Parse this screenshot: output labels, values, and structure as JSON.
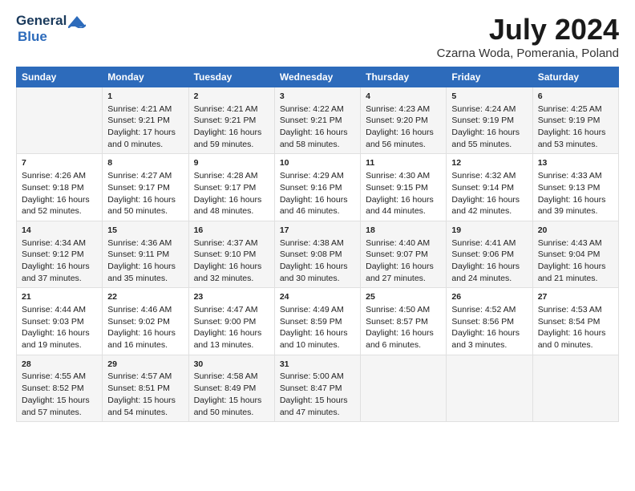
{
  "header": {
    "logo_general": "General",
    "logo_blue": "Blue",
    "main_title": "July 2024",
    "subtitle": "Czarna Woda, Pomerania, Poland"
  },
  "calendar": {
    "weekdays": [
      "Sunday",
      "Monday",
      "Tuesday",
      "Wednesday",
      "Thursday",
      "Friday",
      "Saturday"
    ],
    "weeks": [
      [
        {
          "day": "",
          "content": ""
        },
        {
          "day": "1",
          "content": "Sunrise: 4:21 AM\nSunset: 9:21 PM\nDaylight: 17 hours\nand 0 minutes."
        },
        {
          "day": "2",
          "content": "Sunrise: 4:21 AM\nSunset: 9:21 PM\nDaylight: 16 hours\nand 59 minutes."
        },
        {
          "day": "3",
          "content": "Sunrise: 4:22 AM\nSunset: 9:21 PM\nDaylight: 16 hours\nand 58 minutes."
        },
        {
          "day": "4",
          "content": "Sunrise: 4:23 AM\nSunset: 9:20 PM\nDaylight: 16 hours\nand 56 minutes."
        },
        {
          "day": "5",
          "content": "Sunrise: 4:24 AM\nSunset: 9:19 PM\nDaylight: 16 hours\nand 55 minutes."
        },
        {
          "day": "6",
          "content": "Sunrise: 4:25 AM\nSunset: 9:19 PM\nDaylight: 16 hours\nand 53 minutes."
        }
      ],
      [
        {
          "day": "7",
          "content": "Sunrise: 4:26 AM\nSunset: 9:18 PM\nDaylight: 16 hours\nand 52 minutes."
        },
        {
          "day": "8",
          "content": "Sunrise: 4:27 AM\nSunset: 9:17 PM\nDaylight: 16 hours\nand 50 minutes."
        },
        {
          "day": "9",
          "content": "Sunrise: 4:28 AM\nSunset: 9:17 PM\nDaylight: 16 hours\nand 48 minutes."
        },
        {
          "day": "10",
          "content": "Sunrise: 4:29 AM\nSunset: 9:16 PM\nDaylight: 16 hours\nand 46 minutes."
        },
        {
          "day": "11",
          "content": "Sunrise: 4:30 AM\nSunset: 9:15 PM\nDaylight: 16 hours\nand 44 minutes."
        },
        {
          "day": "12",
          "content": "Sunrise: 4:32 AM\nSunset: 9:14 PM\nDaylight: 16 hours\nand 42 minutes."
        },
        {
          "day": "13",
          "content": "Sunrise: 4:33 AM\nSunset: 9:13 PM\nDaylight: 16 hours\nand 39 minutes."
        }
      ],
      [
        {
          "day": "14",
          "content": "Sunrise: 4:34 AM\nSunset: 9:12 PM\nDaylight: 16 hours\nand 37 minutes."
        },
        {
          "day": "15",
          "content": "Sunrise: 4:36 AM\nSunset: 9:11 PM\nDaylight: 16 hours\nand 35 minutes."
        },
        {
          "day": "16",
          "content": "Sunrise: 4:37 AM\nSunset: 9:10 PM\nDaylight: 16 hours\nand 32 minutes."
        },
        {
          "day": "17",
          "content": "Sunrise: 4:38 AM\nSunset: 9:08 PM\nDaylight: 16 hours\nand 30 minutes."
        },
        {
          "day": "18",
          "content": "Sunrise: 4:40 AM\nSunset: 9:07 PM\nDaylight: 16 hours\nand 27 minutes."
        },
        {
          "day": "19",
          "content": "Sunrise: 4:41 AM\nSunset: 9:06 PM\nDaylight: 16 hours\nand 24 minutes."
        },
        {
          "day": "20",
          "content": "Sunrise: 4:43 AM\nSunset: 9:04 PM\nDaylight: 16 hours\nand 21 minutes."
        }
      ],
      [
        {
          "day": "21",
          "content": "Sunrise: 4:44 AM\nSunset: 9:03 PM\nDaylight: 16 hours\nand 19 minutes."
        },
        {
          "day": "22",
          "content": "Sunrise: 4:46 AM\nSunset: 9:02 PM\nDaylight: 16 hours\nand 16 minutes."
        },
        {
          "day": "23",
          "content": "Sunrise: 4:47 AM\nSunset: 9:00 PM\nDaylight: 16 hours\nand 13 minutes."
        },
        {
          "day": "24",
          "content": "Sunrise: 4:49 AM\nSunset: 8:59 PM\nDaylight: 16 hours\nand 10 minutes."
        },
        {
          "day": "25",
          "content": "Sunrise: 4:50 AM\nSunset: 8:57 PM\nDaylight: 16 hours\nand 6 minutes."
        },
        {
          "day": "26",
          "content": "Sunrise: 4:52 AM\nSunset: 8:56 PM\nDaylight: 16 hours\nand 3 minutes."
        },
        {
          "day": "27",
          "content": "Sunrise: 4:53 AM\nSunset: 8:54 PM\nDaylight: 16 hours\nand 0 minutes."
        }
      ],
      [
        {
          "day": "28",
          "content": "Sunrise: 4:55 AM\nSunset: 8:52 PM\nDaylight: 15 hours\nand 57 minutes."
        },
        {
          "day": "29",
          "content": "Sunrise: 4:57 AM\nSunset: 8:51 PM\nDaylight: 15 hours\nand 54 minutes."
        },
        {
          "day": "30",
          "content": "Sunrise: 4:58 AM\nSunset: 8:49 PM\nDaylight: 15 hours\nand 50 minutes."
        },
        {
          "day": "31",
          "content": "Sunrise: 5:00 AM\nSunset: 8:47 PM\nDaylight: 15 hours\nand 47 minutes."
        },
        {
          "day": "",
          "content": ""
        },
        {
          "day": "",
          "content": ""
        },
        {
          "day": "",
          "content": ""
        }
      ]
    ]
  }
}
